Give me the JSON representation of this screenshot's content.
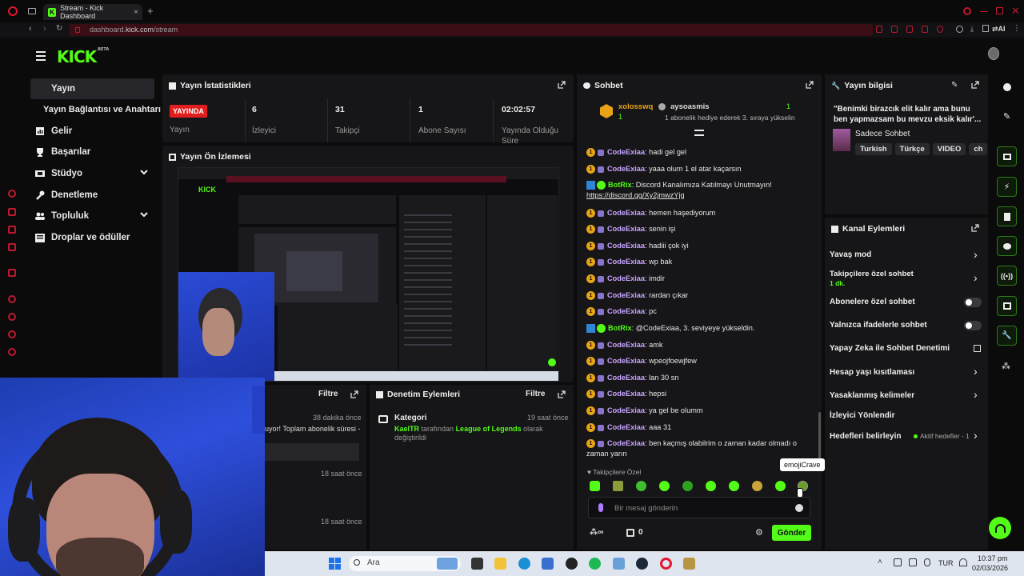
{
  "browser": {
    "tab_title": "Stream - Kick Dashboard",
    "url_domain": "dashboard.",
    "url_host": "kick.com",
    "url_path": "/stream"
  },
  "header": {
    "logo_text": "KICK",
    "logo_beta": "BETA"
  },
  "nav": {
    "items": [
      {
        "label": "Yayın",
        "icon": "broadcast-icon",
        "active": true
      },
      {
        "label": "Yayın Bağlantısı ve Anahtarı",
        "icon": "",
        "sub": true
      },
      {
        "label": "Gelir",
        "icon": "chart-icon"
      },
      {
        "label": "Başarılar",
        "icon": "trophy-icon"
      },
      {
        "label": "Stüdyo",
        "icon": "studio-icon",
        "expandable": true
      },
      {
        "label": "Denetleme",
        "icon": "wrench-icon"
      },
      {
        "label": "Topluluk",
        "icon": "community-icon",
        "expandable": true
      },
      {
        "label": "Droplar ve ödüller",
        "icon": "gift-icon"
      }
    ]
  },
  "stats": {
    "title": "Yayın İstatistikleri",
    "live_badge": "YAYINDA",
    "live_label": "Yayın",
    "viewers_value": "6",
    "viewers_label": "İzleyici",
    "followers_value": "31",
    "followers_label": "Takipçi",
    "subs_value": "1",
    "subs_label": "Abone Sayısı",
    "uptime_value": "02:02:57",
    "uptime_label": "Yayında Olduğu Süre"
  },
  "preview": {
    "title": "Yayın Ön İzlemesi"
  },
  "filter_panel": {
    "filter_label": "Filtre",
    "rows": [
      {
        "time": "38 dakika önce",
        "text": "uyor! Toplam abonelik süresi -"
      },
      {
        "time": "18 saat önce",
        "text": ""
      },
      {
        "time": "18 saat önce",
        "text": ""
      }
    ]
  },
  "moderation": {
    "title": "Denetim Eylemleri",
    "filter_label": "Filtre",
    "entry_title": "Kategori",
    "entry_time": "19 saat önce",
    "entry_user": "KaelTR",
    "entry_mid": " tarafından ",
    "entry_game": "League of Legends",
    "entry_tail": " olarak değiştirildi"
  },
  "chat": {
    "title": "Sohbet",
    "pinned_user1": "xolosswq",
    "pinned_count": "1",
    "pinned_user2": "aysoasmis",
    "pinned_count2": "1",
    "pinned_note": "1 abonelik hediye ederek 3. sıraya yükselin",
    "messages": [
      {
        "user": "CodeExiaa",
        "text": ": hadi gel gel"
      },
      {
        "user": "CodeExiaa",
        "text": ": yaaa olum 1 el atar kaçarsın"
      },
      {
        "user": "BotRix",
        "bot": true,
        "text": ": Discord Kanalımıza Katılmayı Unutmayın!",
        "link": "https://discord.gg/Xy2jmwzYjg"
      },
      {
        "user": "CodeExiaa",
        "text": ": hemen haşediyorum"
      },
      {
        "user": "CodeExiaa",
        "text": ": senin işi"
      },
      {
        "user": "CodeExiaa",
        "text": ": hadiii çok iyi"
      },
      {
        "user": "CodeExiaa",
        "text": ": wp bak"
      },
      {
        "user": "CodeExiaa",
        "text": ": imdir"
      },
      {
        "user": "CodeExiaa",
        "text": ": rardan çıkar"
      },
      {
        "user": "CodeExiaa",
        "text": ": pc"
      },
      {
        "user": "BotRix",
        "bot": true,
        "text": ": @CodeExiaa, 3. seviyeye yükseldin."
      },
      {
        "user": "CodeExiaa",
        "text": ": amk"
      },
      {
        "user": "CodeExiaa",
        "text": ": wpeojfoewjfew"
      },
      {
        "user": "CodeExiaa",
        "text": ": lan 30 sn"
      },
      {
        "user": "CodeExiaa",
        "text": ": hepsi"
      },
      {
        "user": "CodeExiaa",
        "text": ": ya gel be olumm"
      },
      {
        "user": "CodeExiaa",
        "text": ": aaa 31"
      },
      {
        "user": "CodeExiaa",
        "text": ": ben kaçmış olabilrim o zaman kadar olmadı o zaman yarın"
      }
    ],
    "followers_only": "Takipçilere Özel",
    "tooltip": "emojiCrave",
    "input_placeholder": "Bir mesaj gönderin",
    "count": "0",
    "send_label": "Gönder"
  },
  "stream_info": {
    "title": "Yayın bilgisi",
    "stream_title": "\"Benimki birazcık elit kalır ama bunu ben yapmazsam bu mevzu eksik kalır'...",
    "category": "Sadece Sohbet",
    "tags": [
      "Turkish",
      "Türkçe",
      "VIDEO",
      "ch"
    ]
  },
  "channel_actions": {
    "title": "Kanal Eylemleri",
    "slow_mode": "Yavaş mod",
    "followers_chat": "Takipçilere özel sohbet",
    "followers_chat_sub": "1 dk.",
    "subs_chat": "Abonelere özel sohbet",
    "emotes_chat": "Yalnızca ifadelerle sohbet",
    "ai_mod": "Yapay Zeka ile Sohbet Denetimi",
    "age_limit": "Hesap yaşı kısıtlaması",
    "banned_words": "Yasaklanmış kelimeler",
    "redirect": "İzleyici Yönlendir",
    "goals": "Hedefleri belirleyin",
    "goals_status": "Aktif hedefler - 1"
  },
  "taskbar": {
    "search_placeholder": "Ara",
    "lang": "TUR",
    "time": "10:37 pm",
    "date": "02/03/2026"
  },
  "colors": {
    "accent": "#53fc18",
    "live": "#e11d1d",
    "opera": "#c0182f"
  }
}
